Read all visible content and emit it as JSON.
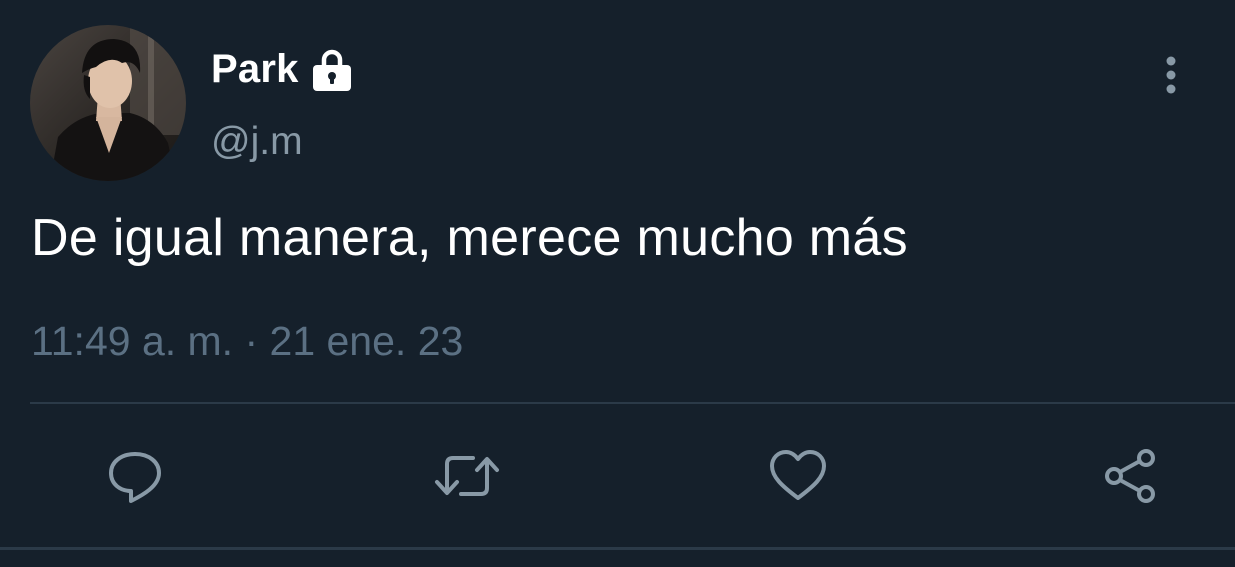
{
  "author": {
    "display_name": "Park",
    "handle": "@j.m",
    "avatar": "profile-photo",
    "protected_icon": "lock-icon"
  },
  "tweet": {
    "text": "De igual manera, merece mucho más",
    "timestamp": "11:49 a. m. · 21 ene. 23"
  },
  "menu_icon": "more-vertical-icon",
  "actions": [
    {
      "icon": "reply-icon"
    },
    {
      "icon": "retweet-icon"
    },
    {
      "icon": "like-icon"
    },
    {
      "icon": "share-icon"
    }
  ],
  "colors": {
    "background": "#15202b",
    "primary_text": "#ffffff",
    "secondary_text": "#8899a6",
    "muted_text": "#5b7083",
    "icon": "#8899a6",
    "divider": "#2b3a48"
  }
}
